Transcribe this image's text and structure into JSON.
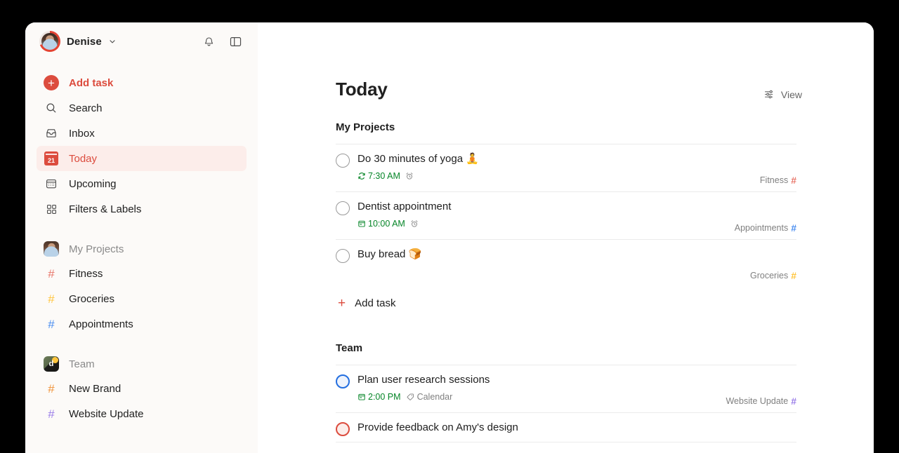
{
  "sidebar": {
    "user": {
      "name": "Denise",
      "chevron_icon": "chevron-down-icon",
      "avatar_icon": "user-avatar"
    },
    "notifications_icon": "bell-icon",
    "panel_toggle_icon": "sidebar-toggle-icon",
    "nav": [
      {
        "label": "Add task",
        "icon": "plus-circle-icon",
        "state": "accent"
      },
      {
        "label": "Search",
        "icon": "search-icon",
        "state": "normal"
      },
      {
        "label": "Inbox",
        "icon": "inbox-icon",
        "state": "normal"
      },
      {
        "label": "Today",
        "icon": "today-calendar-icon",
        "state": "active",
        "day": "21"
      },
      {
        "label": "Upcoming",
        "icon": "upcoming-calendar-icon",
        "state": "normal"
      },
      {
        "label": "Filters & Labels",
        "icon": "filters-labels-icon",
        "state": "normal"
      }
    ],
    "groups": [
      {
        "label": "My Projects",
        "icon": "my-projects-avatar",
        "projects": [
          {
            "label": "Fitness",
            "color": "#E8776B"
          },
          {
            "label": "Groceries",
            "color": "#FFC53D"
          },
          {
            "label": "Appointments",
            "color": "#4A8EF0"
          }
        ]
      },
      {
        "label": "Team",
        "icon": "team-workspace-avatar",
        "initial": "d",
        "projects": [
          {
            "label": "New Brand",
            "color": "#F0933A"
          },
          {
            "label": "Website Update",
            "color": "#9B7EE8"
          }
        ]
      }
    ]
  },
  "main": {
    "view_button": {
      "label": "View",
      "icon": "sliders-icon"
    },
    "page_title": "Today",
    "sections": [
      {
        "title": "My Projects",
        "tasks": [
          {
            "title": "Do 30 minutes of yoga 🧘",
            "priority": "none",
            "date_icon": "recurring-icon",
            "date": "7:30 AM",
            "reminder_icon": "alarm-clock-icon",
            "project": "Fitness",
            "project_color": "#E8776B"
          },
          {
            "title": "Dentist appointment",
            "priority": "none",
            "date_icon": "calendar-icon",
            "date": "10:00 AM",
            "reminder_icon": "alarm-clock-icon",
            "project": "Appointments",
            "project_color": "#4A8EF0"
          },
          {
            "title": "Buy bread 🍞",
            "priority": "none",
            "date_icon": "",
            "date": "",
            "reminder_icon": "",
            "project": "Groceries",
            "project_color": "#FFC53D"
          }
        ],
        "add_task_label": "Add task",
        "add_task_icon": "plus-icon"
      },
      {
        "title": "Team",
        "tasks": [
          {
            "title": "Plan user research sessions",
            "priority": "p2",
            "date_icon": "calendar-icon",
            "date": "2:00 PM",
            "label_icon": "tag-icon",
            "label": "Calendar",
            "project": "Website Update",
            "project_color": "#9B7EE8"
          },
          {
            "title": "Provide feedback on Amy's design",
            "priority": "p1",
            "date_icon": "",
            "date": "",
            "project": "",
            "project_color": "#9B7EE8"
          }
        ]
      }
    ]
  },
  "colors": {
    "accent": "#DC4C3E",
    "sidebar_bg": "#FCFAF8",
    "active_bg": "#FCEDEA",
    "date_green": "#058527",
    "muted": "#808080"
  }
}
